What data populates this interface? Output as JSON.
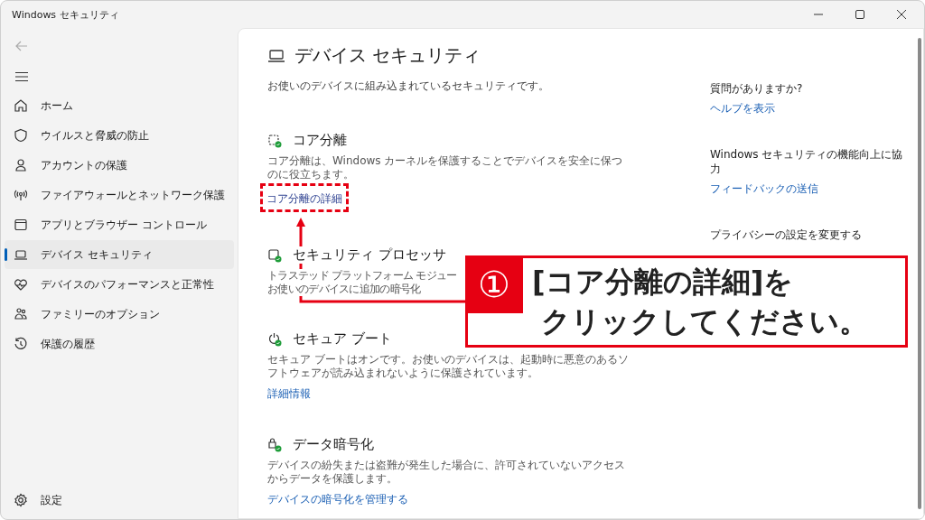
{
  "window": {
    "title": "Windows セキュリティ"
  },
  "sidebar": {
    "items": [
      {
        "label": "ホーム",
        "selected": false
      },
      {
        "label": "ウイルスと脅威の防止",
        "selected": false
      },
      {
        "label": "アカウントの保護",
        "selected": false
      },
      {
        "label": "ファイアウォールとネットワーク保護",
        "selected": false
      },
      {
        "label": "アプリとブラウザー コントロール",
        "selected": false
      },
      {
        "label": "デバイス セキュリティ",
        "selected": true
      },
      {
        "label": "デバイスのパフォーマンスと正常性",
        "selected": false
      },
      {
        "label": "ファミリーのオプション",
        "selected": false
      },
      {
        "label": "保護の履歴",
        "selected": false
      }
    ],
    "settings": "設定"
  },
  "page": {
    "title": "デバイス セキュリティ",
    "subtitle": "お使いのデバイスに組み込まれているセキュリティです。",
    "sections": [
      {
        "title": "コア分離",
        "description": "コア分離は、Windows カーネルを保護することでデバイスを安全に保つのに役立ちます。",
        "link": "コア分離の詳細"
      },
      {
        "title": "セキュリティ プロセッサ",
        "description_lines": [
          "トラステッド プラットフォーム モジュー",
          "お使いのデバイスに追加の暗号化"
        ]
      },
      {
        "title": "セキュア ブート",
        "description": "セキュア ブートはオンです。お使いのデバイスは、起動時に悪意のあるソフトウェアが読み込まれないように保護されています。",
        "link": "詳細情報"
      },
      {
        "title": "データ暗号化",
        "description": "デバイスの紛失または盗難が発生した場合に、許可されていないアクセスからデータを保護します。",
        "link": "デバイスの暗号化を管理する"
      }
    ]
  },
  "aside": [
    {
      "heading": "質問がありますか?",
      "link": "ヘルプを表示"
    },
    {
      "heading": "Windows セキュリティの機能向上に協力",
      "link": "フィードバックの送信"
    },
    {
      "heading": "プライバシーの設定を変更する"
    }
  ],
  "callout": {
    "number": "①",
    "lines": [
      "[コア分離の詳細]を",
      "クリックしてください。"
    ]
  }
}
